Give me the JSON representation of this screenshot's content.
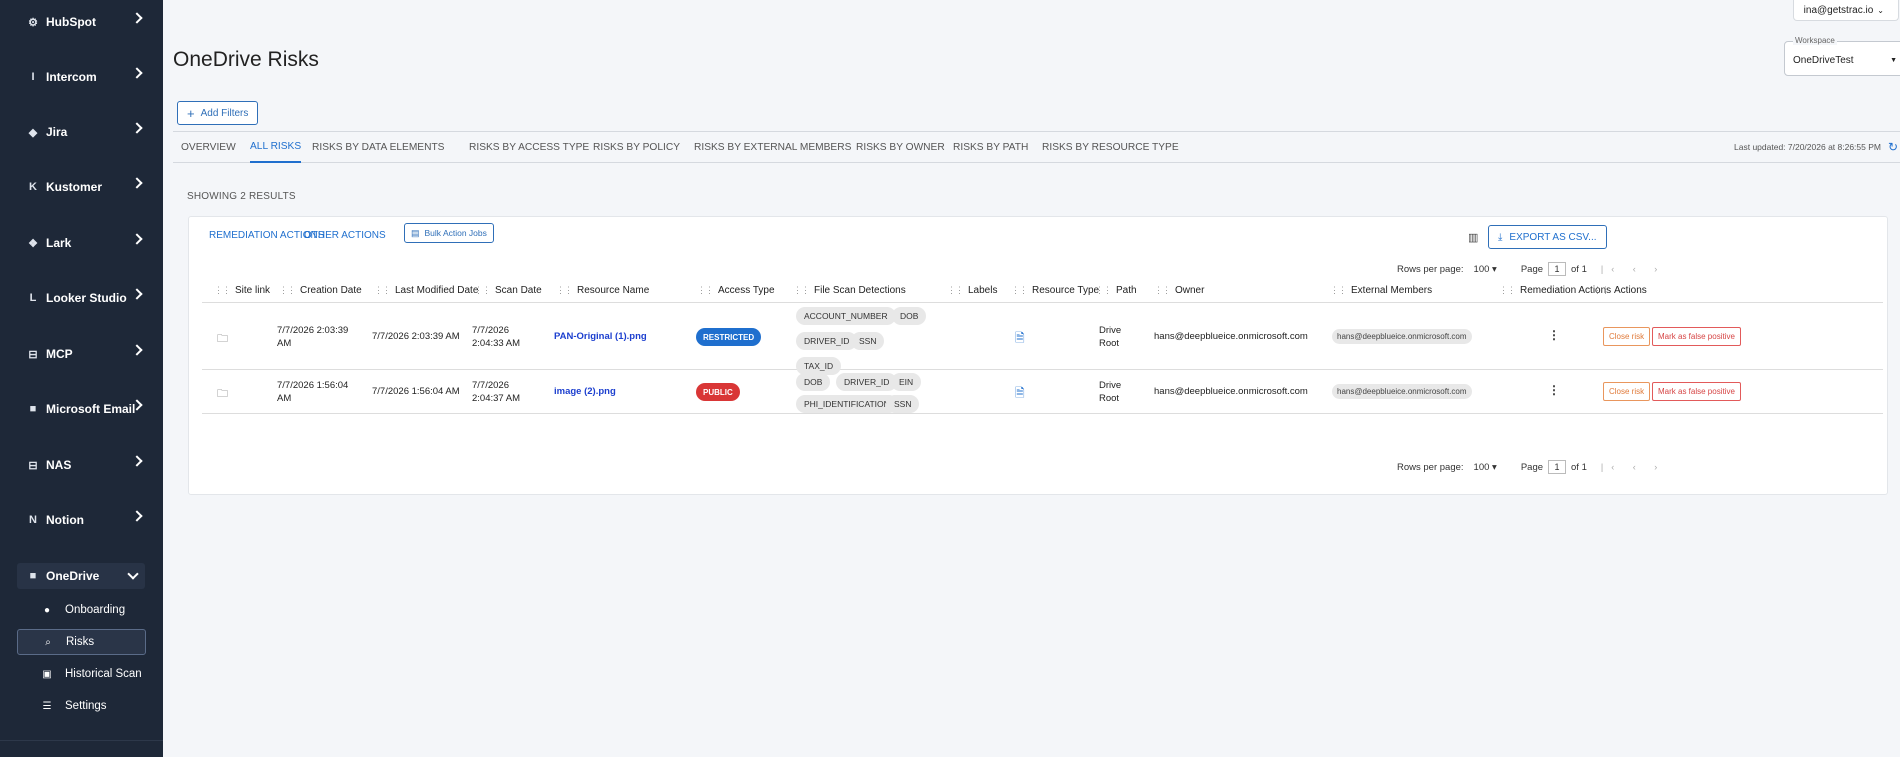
{
  "sidebar": {
    "items": [
      {
        "label": "HubSpot",
        "icon": "hubspot-icon",
        "glyph": "⚙"
      },
      {
        "label": "Intercom",
        "icon": "intercom-icon",
        "glyph": "I"
      },
      {
        "label": "Jira",
        "icon": "jira-icon",
        "glyph": "◆"
      },
      {
        "label": "Kustomer",
        "icon": "kustomer-icon",
        "glyph": "K"
      },
      {
        "label": "Lark",
        "icon": "lark-icon",
        "glyph": "❖"
      },
      {
        "label": "Looker Studio",
        "icon": "looker-icon",
        "glyph": "L"
      },
      {
        "label": "MCP",
        "icon": "mcp-icon",
        "glyph": "⊟"
      },
      {
        "label": "Microsoft Email",
        "icon": "microsoft-icon",
        "glyph": "■"
      },
      {
        "label": "NAS",
        "icon": "nas-icon",
        "glyph": "⊟"
      },
      {
        "label": "Notion",
        "icon": "notion-icon",
        "glyph": "N"
      }
    ],
    "active_group": {
      "label": "OneDrive",
      "icon": "onedrive-icon",
      "glyph": "■"
    },
    "sub_items": [
      {
        "label": "Onboarding",
        "icon": "person-icon",
        "glyph": "●"
      },
      {
        "label": "Risks",
        "icon": "search-icon",
        "glyph": "⌕"
      },
      {
        "label": "Historical Scan",
        "icon": "briefcase-icon",
        "glyph": "▣"
      },
      {
        "label": "Settings",
        "icon": "database-icon",
        "glyph": "☰"
      }
    ]
  },
  "header": {
    "user_email": "ina@getstrac.io",
    "title": "OneDrive Risks",
    "workspace_label": "Workspace",
    "workspace_value": "OneDriveTest"
  },
  "filters": {
    "add_label": "Add Filters"
  },
  "tabs": [
    "OVERVIEW",
    "ALL RISKS",
    "RISKS BY DATA ELEMENTS",
    "RISKS BY ACCESS TYPE",
    "RISKS BY POLICY",
    "RISKS BY EXTERNAL MEMBERS",
    "RISKS BY OWNER",
    "RISKS BY PATH",
    "RISKS BY RESOURCE TYPE"
  ],
  "last_updated": "Last updated: 7/20/2026 at 8:26:55 PM",
  "showing": "SHOWING 2 RESULTS",
  "toolbar": {
    "remediation_actions": "REMEDIATION ACTIONS",
    "other_actions": "OTHER ACTIONS",
    "bulk_action_jobs": "Bulk Action Jobs",
    "export": "EXPORT AS CSV..."
  },
  "pagination": {
    "rows_per_page_label": "Rows per page:",
    "rows_per_page": "100",
    "page_label": "Page",
    "page": "1",
    "of_label": "of 1"
  },
  "columns": [
    "Site link",
    "Creation Date",
    "Last Modified Date",
    "Scan Date",
    "Resource Name",
    "Access Type",
    "File Scan Detections",
    "Labels",
    "Resource Type",
    "Path",
    "Owner",
    "External Members",
    "Remediation Actions",
    "Actions"
  ],
  "rows": [
    {
      "creation_l1": "7/7/2026 2:03:39",
      "creation_l2": "AM",
      "modified": "7/7/2026 2:03:39 AM",
      "scan_l1": "7/7/2026",
      "scan_l2": "2:04:33 AM",
      "resource_name": "PAN-Original (1).png",
      "access": "RESTRICTED",
      "access_color": "#1f6fce",
      "detections": [
        "ACCOUNT_NUMBER",
        "DOB",
        "DRIVER_ID",
        "SSN",
        "TAX_ID"
      ],
      "path_l1": "Drive",
      "path_l2": "Root",
      "owner": "hans@deepblueice.onmicrosoft.com",
      "external_member": "hans@deepblueice.onmicrosoft.com",
      "close_label": "Close risk",
      "false_label": "Mark as false positive"
    },
    {
      "creation_l1": "7/7/2026 1:56:04",
      "creation_l2": "AM",
      "modified": "7/7/2026 1:56:04 AM",
      "scan_l1": "7/7/2026",
      "scan_l2": "2:04:37 AM",
      "resource_name": "image (2).png",
      "access": "PUBLIC",
      "access_color": "#d93636",
      "detections": [
        "DOB",
        "DRIVER_ID",
        "EIN",
        "PHI_IDENTIFICATION",
        "SSN"
      ],
      "path_l1": "Drive",
      "path_l2": "Root",
      "owner": "hans@deepblueice.onmicrosoft.com",
      "external_member": "hans@deepblueice.onmicrosoft.com",
      "close_label": "Close risk",
      "false_label": "Mark as false positive"
    }
  ]
}
